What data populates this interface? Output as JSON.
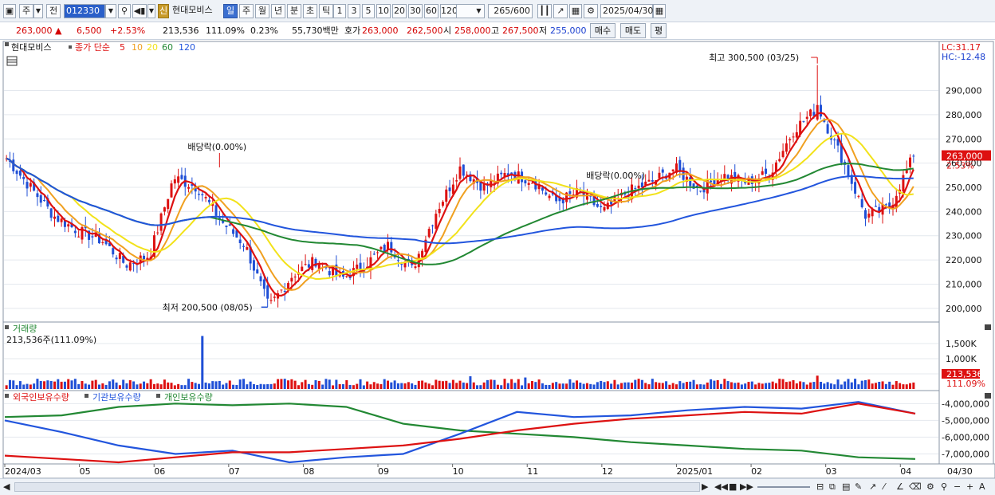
{
  "toolbar": {
    "period_label": "주",
    "prev_label": "전",
    "stock_code": "012330",
    "shin_label": "신",
    "stock_name": "현대모비스",
    "periods": [
      "일",
      "주",
      "월",
      "년",
      "분",
      "초",
      "틱"
    ],
    "active_period": "일",
    "intervals": [
      "1",
      "3",
      "5",
      "10",
      "20",
      "30",
      "60",
      "120"
    ],
    "count": "265",
    "count_total": "/600",
    "date": "2025/04/30"
  },
  "quote": {
    "price": "263,000",
    "change": "6,500",
    "change_pct": "+2.53%",
    "volume": "213,536",
    "volume_pct": "111.09%",
    "turnover": "0.23%",
    "amount": "55,730백만",
    "bid_label": "호가",
    "bid": "263,000",
    "ask": "262,500",
    "open_label": "시",
    "open": "258,000",
    "high_label": "고",
    "high": "267,500",
    "low_label": "저",
    "low": "255,000",
    "buy_label": "매수",
    "sell_label": "매도",
    "eval_label": "평"
  },
  "price_panel": {
    "legend_name": "현대모비스",
    "legend_ma": "종가 단순",
    "ma_periods": [
      "5",
      "10",
      "20",
      "60",
      "120"
    ],
    "ma_colors": [
      "#dd1111",
      "#f0a020",
      "#f2e21a",
      "#228833",
      "#2255dd"
    ],
    "lc": "LC:31.17",
    "hc": "HC:-12.48",
    "max_note": "최고 300,500 (03/25)",
    "min_note": "최저 200,500 (08/05)",
    "div_note_1": "배당락(0.00%)",
    "div_note_2": "배당락(0.00%)",
    "last_price": "263,000",
    "last_pct": "2.53%",
    "y_ticks": [
      "290,000",
      "280,000",
      "270,000",
      "260,000",
      "250,000",
      "240,000",
      "230,000",
      "220,000",
      "210,000",
      "200,000"
    ]
  },
  "volume_panel": {
    "title": "거래량",
    "current": "213,536주(111.09%)",
    "last_value": "213,536",
    "last_pct": "111.09%",
    "y_ticks": [
      "1,500K",
      "1,000K",
      "500K"
    ]
  },
  "holdings_panel": {
    "legend_foreign": "외국인보유수량",
    "legend_inst": "기관보유수량",
    "legend_indiv": "개인보유수량",
    "colors": {
      "foreign": "#dd1111",
      "inst": "#2255dd",
      "indiv": "#228833"
    },
    "y_ticks": [
      "-4,000,000",
      "-5,000,000",
      "-6,000,000",
      "-7,000,000"
    ]
  },
  "x_axis": {
    "labels": [
      "2024/03",
      "05",
      "06",
      "07",
      "08",
      "09",
      "10",
      "11",
      "12",
      "2025/01",
      "02",
      "03",
      "04"
    ],
    "end_label": "04/30"
  },
  "chart_data": {
    "type": "candlestick",
    "title": "현대모비스",
    "x_start": "2024/03",
    "x_end": "2025/04/30",
    "ylim": [
      195000,
      305000
    ],
    "ma_periods": [
      5,
      10,
      20,
      60,
      120
    ],
    "close_path": [
      {
        "date": "2024/03",
        "close": 262000
      },
      {
        "date": "04",
        "close": 250000
      },
      {
        "date": "04",
        "close": 238000
      },
      {
        "date": "05",
        "close": 232000
      },
      {
        "date": "05",
        "close": 228000
      },
      {
        "date": "06",
        "close": 218000
      },
      {
        "date": "06",
        "close": 222000
      },
      {
        "date": "06",
        "close": 254000
      },
      {
        "date": "07",
        "close": 250000
      },
      {
        "date": "07",
        "close": 236000
      },
      {
        "date": "07",
        "close": 226000
      },
      {
        "date": "08/05",
        "close": 200500
      },
      {
        "date": "08",
        "close": 214000
      },
      {
        "date": "08",
        "close": 220000
      },
      {
        "date": "09",
        "close": 212000
      },
      {
        "date": "09",
        "close": 218000
      },
      {
        "date": "09",
        "close": 226000
      },
      {
        "date": "10",
        "close": 216000
      },
      {
        "date": "10",
        "close": 240000
      },
      {
        "date": "10",
        "close": 258000
      },
      {
        "date": "11",
        "close": 250000
      },
      {
        "date": "11",
        "close": 256000
      },
      {
        "date": "11",
        "close": 253000
      },
      {
        "date": "12",
        "close": 244000
      },
      {
        "date": "12",
        "close": 248000
      },
      {
        "date": "12",
        "close": 240000
      },
      {
        "date": "2025/01",
        "close": 248000
      },
      {
        "date": "2025/01",
        "close": 252000
      },
      {
        "date": "02",
        "close": 258000
      },
      {
        "date": "02",
        "close": 249000
      },
      {
        "date": "02",
        "close": 255000
      },
      {
        "date": "03",
        "close": 252000
      },
      {
        "date": "03",
        "close": 256000
      },
      {
        "date": "03",
        "close": 274000
      },
      {
        "date": "03/25",
        "close": 283000
      },
      {
        "date": "04",
        "close": 262000
      },
      {
        "date": "04",
        "close": 238000
      },
      {
        "date": "04",
        "close": 242000
      },
      {
        "date": "04/30",
        "close": 263000
      }
    ],
    "max": {
      "date": "03/25",
      "value": 300500
    },
    "min": {
      "date": "08/05",
      "value": 200500
    },
    "volume_ylim": [
      0,
      2000
    ],
    "volume_unit": "K",
    "volume_last": 213.536,
    "holdings_ylim": [
      -7500000,
      -3700000
    ],
    "holdings": {
      "foreign": [
        -7100000,
        -7300000,
        -7500000,
        -7200000,
        -6900000,
        -6900000,
        -6700000,
        -6500000,
        -6100000,
        -5600000,
        -5200000,
        -4900000,
        -4700000,
        -4500000,
        -4600000,
        -4000000,
        -4600000
      ],
      "inst": [
        -5000000,
        -5700000,
        -6500000,
        -7000000,
        -6800000,
        -7500000,
        -7200000,
        -7000000,
        -5800000,
        -4500000,
        -4800000,
        -4700000,
        -4400000,
        -4200000,
        -4300000,
        -3900000,
        -4600000
      ],
      "indiv": [
        -4800000,
        -4700000,
        -4200000,
        -4000000,
        -4100000,
        -4000000,
        -4200000,
        -5200000,
        -5600000,
        -5800000,
        -6000000,
        -6300000,
        -6500000,
        -6700000,
        -6800000,
        -7200000,
        -7300000
      ]
    }
  },
  "status_bar": {
    "scroll_left": "◀",
    "scroll_right": "▶"
  }
}
